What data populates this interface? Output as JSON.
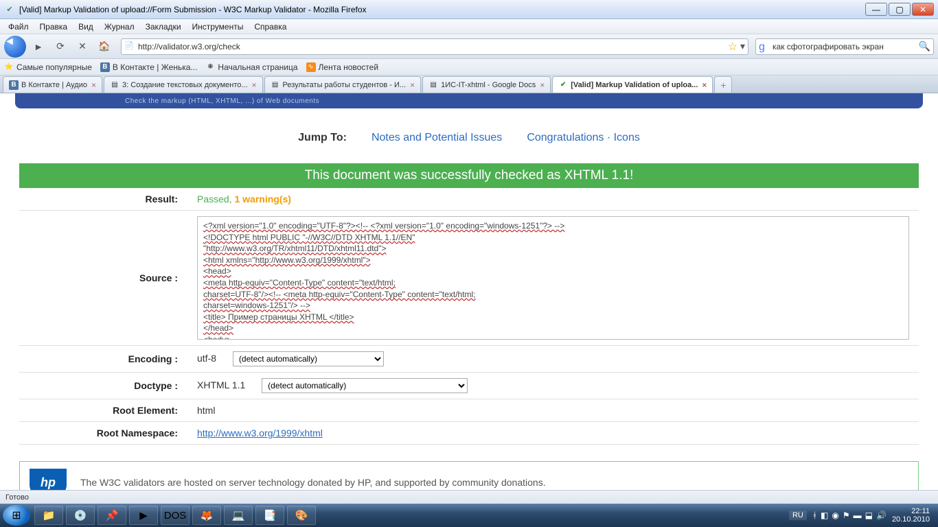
{
  "window": {
    "title": "[Valid] Markup Validation of upload://Form Submission - W3C Markup Validator - Mozilla Firefox"
  },
  "menu": [
    "Файл",
    "Правка",
    "Вид",
    "Журнал",
    "Закладки",
    "Инструменты",
    "Справка"
  ],
  "nav": {
    "url": "http://validator.w3.org/check",
    "search": "как сфотографировать экран"
  },
  "bookmarks": [
    {
      "icon": "star",
      "label": "Самые популярные"
    },
    {
      "icon": "vk",
      "label": "В Контакте | Женька..."
    },
    {
      "icon": "gear",
      "label": "Начальная страница"
    },
    {
      "icon": "rss",
      "label": "Лента новостей"
    }
  ],
  "tabs": [
    {
      "icon": "vk",
      "label": "В Контакте | Аудио",
      "active": false
    },
    {
      "icon": "doc",
      "label": "3: Создание текстовых документо...",
      "active": false
    },
    {
      "icon": "doc",
      "label": "Результаты работы студентов - И...",
      "active": false
    },
    {
      "icon": "doc",
      "label": "1ИС-IT-xhtml - Google Docs",
      "active": false
    },
    {
      "icon": "valid",
      "label": "[Valid] Markup Validation of uploa...",
      "active": true
    }
  ],
  "banner": "Check the markup (HTML, XHTML, ...) of Web documents",
  "jumpto": {
    "label": "Jump To:",
    "links": [
      "Notes and Potential Issues",
      "Congratulations · Icons"
    ]
  },
  "success": "This document was successfully checked as XHTML 1.1!",
  "rows": {
    "result_label": "Result:",
    "passed": "Passed, ",
    "warnings": "1 warning(s)",
    "source_label": "Source :",
    "encoding_label": "Encoding :",
    "encoding_value": "utf-8",
    "encoding_dd": "(detect automatically)",
    "doctype_label": "Doctype :",
    "doctype_value": "XHTML 1.1",
    "doctype_dd": "(detect automatically)",
    "rootel_label": "Root Element:",
    "rootel_value": "html",
    "rootns_label": "Root Namespace:",
    "rootns_value": "http://www.w3.org/1999/xhtml"
  },
  "source_lines": [
    "<?xml version=\"1.0\" encoding=\"UTF-8\"?><!-- <?xml version=\"1.0\" encoding=\"windows-1251\"?> -->",
    "<!DOCTYPE html PUBLIC \"-//W3C//DTD XHTML 1.1//EN\"",
    "\"http://www.w3.org/TR/xhtml11/DTD/xhtml11.dtd\">",
    "<html xmlns=\"http://www.w3.org/1999/xhtml\">",
    "<head>",
    "<meta http-equiv=\"Content-Type\" content=\"text/html;",
    "charset=UTF-8\"/><!-- <meta http-equiv=\"Content-Type\" content=\"text/html;",
    "charset=windows-1251\"/> -->",
    "<title> Пример страницы XHTML </title>",
    "</head>",
    "<body>"
  ],
  "sponsor": "The W3C validators are hosted on server technology donated by HP, and supported by community donations.",
  "statusbar": "Готово",
  "taskbar_icons": [
    "📁",
    "💿",
    "📌",
    "▶",
    "DOS",
    "🦊",
    "💻",
    "📑",
    "🎨"
  ],
  "tray": {
    "lang": "RU",
    "time": "22:11",
    "date": "20.10.2010"
  }
}
